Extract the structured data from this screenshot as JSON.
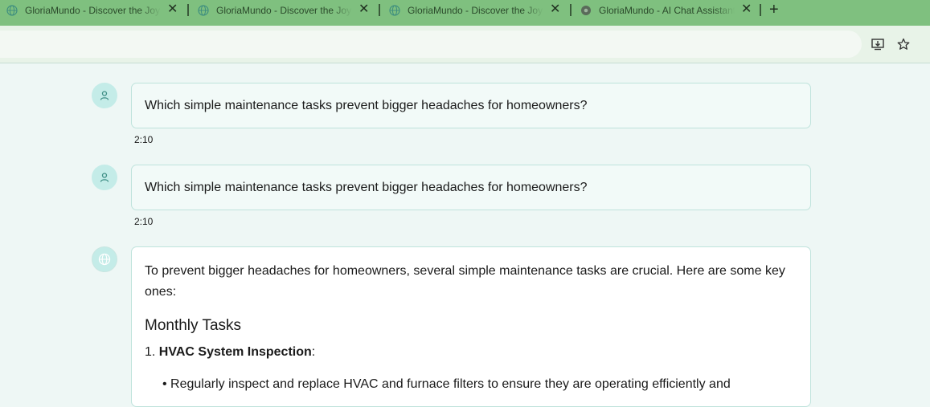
{
  "tabs": [
    {
      "title": "GloriaMundo - Discover the Joy",
      "close": "✕"
    },
    {
      "title": "GloriaMundo - Discover the Joy",
      "close": "✕"
    },
    {
      "title": "GloriaMundo - Discover the Joy",
      "close": "✕"
    },
    {
      "title": "GloriaMundo - AI Chat Assistant",
      "close": "✕"
    }
  ],
  "new_tab": "+",
  "toolbar": {
    "icons": [
      "install-icon",
      "bookmark-star-icon"
    ]
  },
  "messages": [
    {
      "role": "user",
      "text": "Which simple maintenance tasks prevent bigger headaches for homeowners?",
      "time": "2:10"
    },
    {
      "role": "user",
      "text": "Which simple maintenance tasks prevent bigger headaches for homeowners?",
      "time": "2:10"
    },
    {
      "role": "assistant",
      "intro": "To prevent bigger headaches for homeowners, several simple maintenance tasks are crucial. Here are some key ones:",
      "heading": "Monthly Tasks",
      "list_number": "1.",
      "list_item_title": "HVAC System Inspection",
      "list_item_colon": ":",
      "sub_item_partial": "Regularly inspect and replace HVAC and furnace filters to ensure they are operating efficiently and"
    }
  ],
  "colors": {
    "tab_bar": "#7fc07f",
    "accent": "#c4ece8",
    "page_bg": "#eef7f5"
  }
}
